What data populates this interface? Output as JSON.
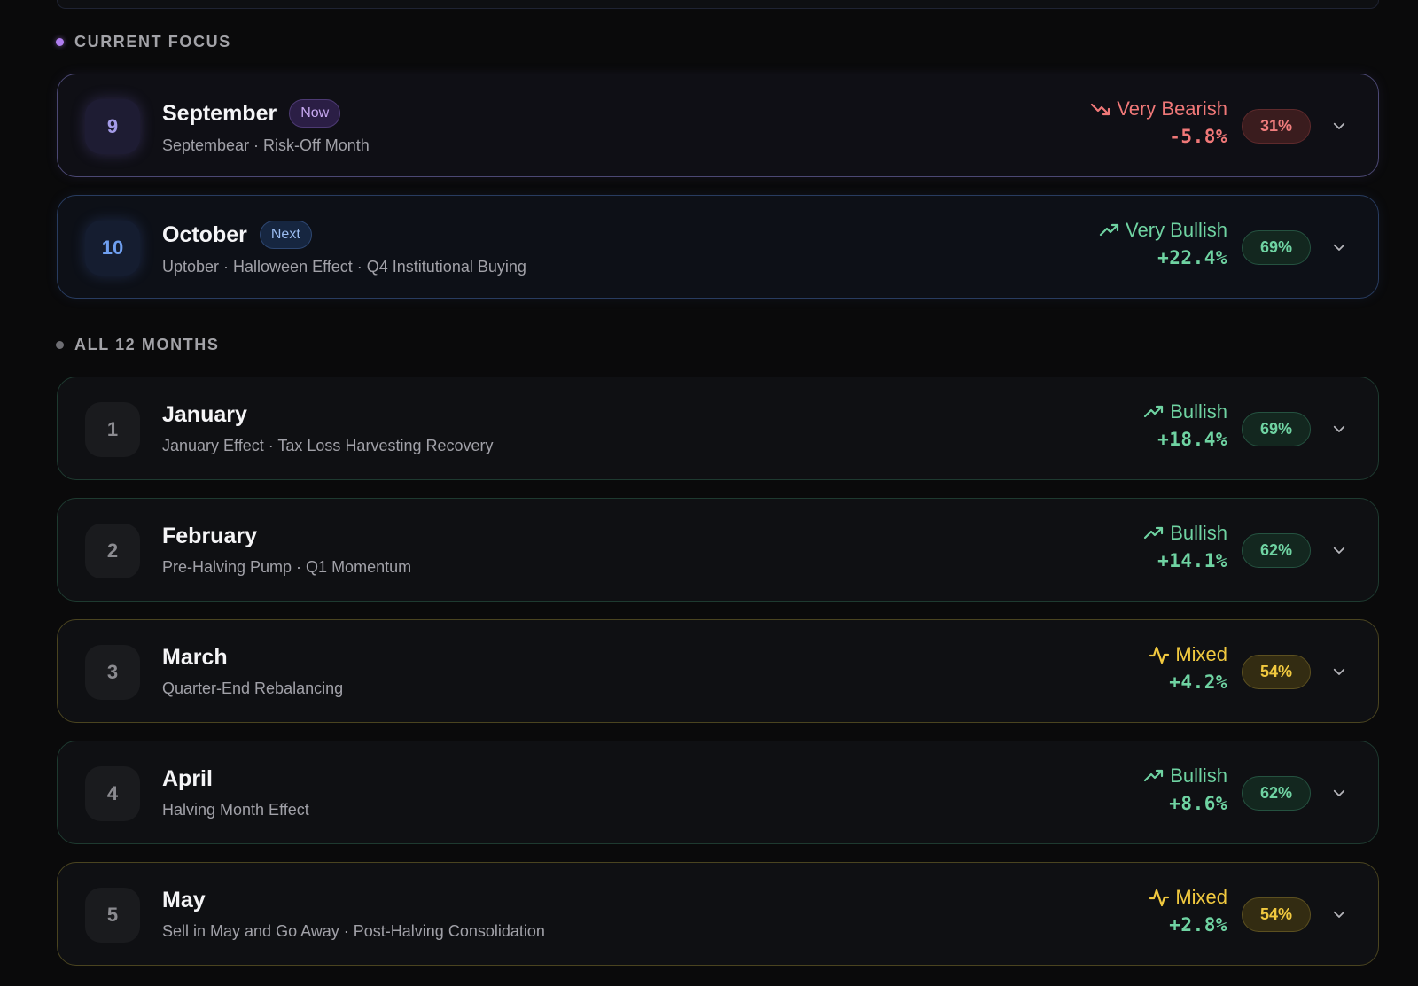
{
  "sections": {
    "current_focus": "CURRENT FOCUS",
    "all_months": "ALL 12 MONTHS"
  },
  "focus_months": [
    {
      "number": "9",
      "name": "September",
      "badge": "Now",
      "subtitle": "Septembear · Risk-Off Month",
      "sentiment": "Very Bearish",
      "return": "-5.8%",
      "probability": "31%",
      "tone": "purple",
      "sentiment_color": "red"
    },
    {
      "number": "10",
      "name": "October",
      "badge": "Next",
      "subtitle": "Uptober · Halloween Effect · Q4 Institutional Buying",
      "sentiment": "Very Bullish",
      "return": "+22.4%",
      "probability": "69%",
      "tone": "blue",
      "sentiment_color": "green"
    }
  ],
  "months": [
    {
      "number": "1",
      "name": "January",
      "subtitle": "January Effect · Tax Loss Harvesting Recovery",
      "sentiment": "Bullish",
      "return": "+18.4%",
      "probability": "69%",
      "tone": "green",
      "sentiment_color": "green"
    },
    {
      "number": "2",
      "name": "February",
      "subtitle": "Pre-Halving Pump · Q1 Momentum",
      "sentiment": "Bullish",
      "return": "+14.1%",
      "probability": "62%",
      "tone": "green",
      "sentiment_color": "green"
    },
    {
      "number": "3",
      "name": "March",
      "subtitle": "Quarter-End Rebalancing",
      "sentiment": "Mixed",
      "return": "+4.2%",
      "probability": "54%",
      "tone": "yellow",
      "sentiment_color": "yellow"
    },
    {
      "number": "4",
      "name": "April",
      "subtitle": "Halving Month Effect",
      "sentiment": "Bullish",
      "return": "+8.6%",
      "probability": "62%",
      "tone": "green",
      "sentiment_color": "green"
    },
    {
      "number": "5",
      "name": "May",
      "subtitle": "Sell in May and Go Away · Post-Halving Consolidation",
      "sentiment": "Mixed",
      "return": "+2.8%",
      "probability": "54%",
      "tone": "yellow",
      "sentiment_color": "yellow"
    }
  ],
  "colors": {
    "red": "#f07878",
    "green": "#6fd3a2",
    "yellow": "#f1c93f",
    "purple_dot": "#b07ef0",
    "gray_dot": "#6e6e73"
  }
}
